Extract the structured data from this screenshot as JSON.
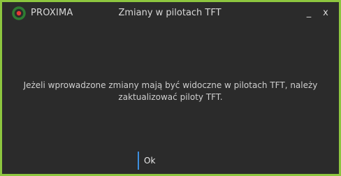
{
  "window": {
    "brand": "PROXIMA",
    "title": "Zmiany w pilotach TFT",
    "minimize_label": "_",
    "close_label": "x"
  },
  "dialog": {
    "message": "Jeżeli wprowadzone zmiany mają być widoczne w pilotach TFT, należy zaktualizować piloty TFT.",
    "ok_label": "Ok"
  },
  "colors": {
    "frame": "#8dc63f",
    "background": "#2b2b2b",
    "text": "#d8d8d8",
    "accent": "#3d8fe0",
    "logo_ring": "#2e7d32",
    "logo_dot": "#e53935"
  },
  "icons": {
    "logo": "proxima-logo-icon"
  }
}
